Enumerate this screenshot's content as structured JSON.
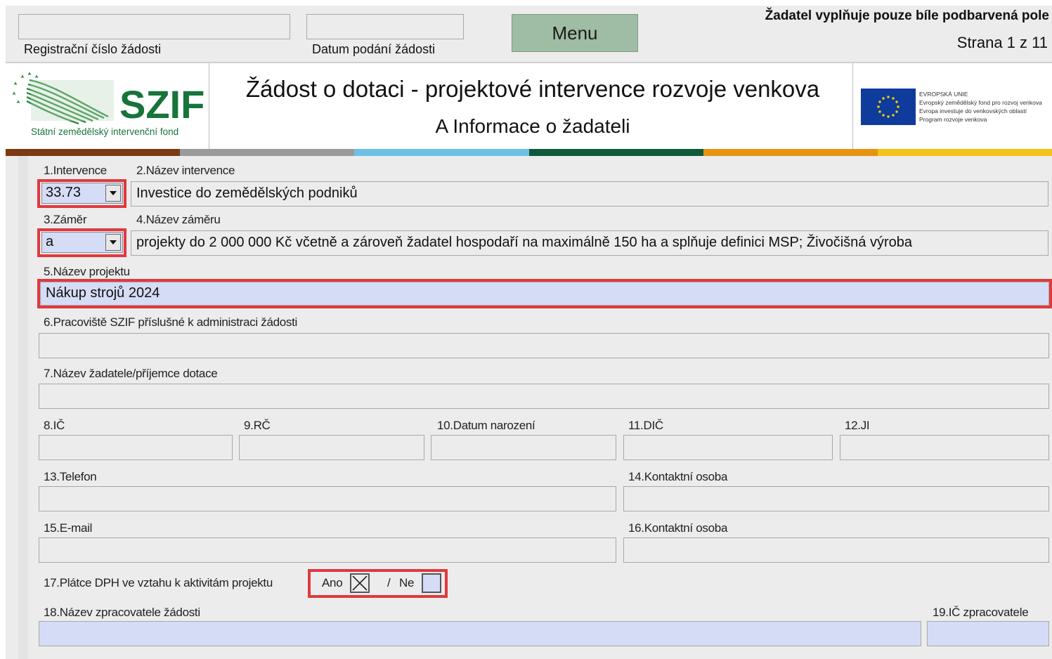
{
  "header": {
    "reg_label": "Registrační číslo žádosti",
    "date_label": "Datum podání žádosti",
    "menu_label": "Menu",
    "note": "Žadatel vyplňuje pouze bíle podbarvená pole",
    "page": "Strana 1 z 11"
  },
  "banner": {
    "logo_text": "SZIF",
    "logo_subtitle": "Státní zemědělský intervenční fond",
    "title": "Žádost o dotaci - projektové intervence rozvoje venkova",
    "subtitle": "A Informace o žadateli",
    "eu_lines": [
      "EVROPSKÁ UNIE",
      "Evropský zemědělský fond pro rozvoj venkova",
      "Evropa investuje do venkovských oblastí",
      "Program rozvoje venkova"
    ]
  },
  "colors": {
    "bar": [
      "#7b3a14",
      "#9a9a9a",
      "#6cc0e6",
      "#0e5a3a",
      "#e69310",
      "#f2c316"
    ],
    "highlight": "#e0393e",
    "field_blue": "#d5dcf5"
  },
  "form": {
    "f1_label": "1.Intervence",
    "f1_value": "33.73",
    "f2_label": "2.Název intervence",
    "f2_value": "Investice do zemědělských podniků",
    "f3_label": "3.Záměr",
    "f3_value": "a",
    "f4_label": "4.Název záměru",
    "f4_value": "projekty do 2 000 000 Kč včetně a zároveň žadatel hospodaří na maximálně 150 ha a splňuje definici MSP; Živočišná výroba",
    "f5_label": "5.Název projektu",
    "f5_value": "Nákup strojů 2024",
    "f6_label": "6.Pracoviště SZIF příslušné k administraci žádosti",
    "f7_label": "7.Název žadatele/příjemce dotace",
    "f8_label": "8.IČ",
    "f9_label": "9.RČ",
    "f10_label": "10.Datum narození",
    "f11_label": "11.DIČ",
    "f12_label": "12.JI",
    "f13_label": "13.Telefon",
    "f14_label": "14.Kontaktní osoba",
    "f15_label": "15.E-mail",
    "f16_label": "16.Kontaktní osoba",
    "f17_label": "17.Plátce DPH ve vztahu k aktivitám projektu",
    "f17_yes": "Ano",
    "f17_sep": "/",
    "f17_no": "Ne",
    "f17_yes_checked": true,
    "f17_no_checked": false,
    "f18_label": "18.Název zpracovatele žádosti",
    "f19_label": "19.IČ zpracovatele"
  }
}
